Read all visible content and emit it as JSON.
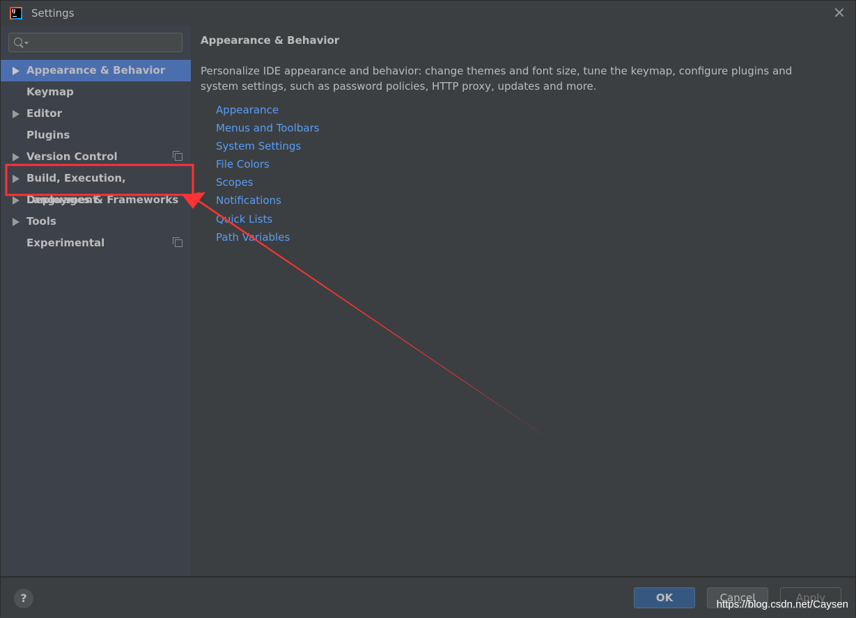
{
  "window": {
    "title": "Settings",
    "app_icon": "intellij-idea-icon",
    "close_icon": "close-icon"
  },
  "sidebar": {
    "search": {
      "value": "",
      "placeholder": ""
    },
    "items": [
      {
        "label": "Appearance & Behavior",
        "expandable": true,
        "selected": true,
        "project_icon": false
      },
      {
        "label": "Keymap",
        "expandable": false,
        "selected": false,
        "project_icon": false
      },
      {
        "label": "Editor",
        "expandable": true,
        "selected": false,
        "project_icon": false
      },
      {
        "label": "Plugins",
        "expandable": false,
        "selected": false,
        "project_icon": false
      },
      {
        "label": "Version Control",
        "expandable": true,
        "selected": false,
        "project_icon": true
      },
      {
        "label": "Build, Execution, Deployment",
        "expandable": true,
        "selected": false,
        "project_icon": false
      },
      {
        "label": "Languages & Frameworks",
        "expandable": true,
        "selected": false,
        "project_icon": false
      },
      {
        "label": "Tools",
        "expandable": true,
        "selected": false,
        "project_icon": false
      },
      {
        "label": "Experimental",
        "expandable": false,
        "selected": false,
        "project_icon": true
      }
    ]
  },
  "content": {
    "heading": "Appearance & Behavior",
    "description": "Personalize IDE appearance and behavior: change themes and font size, tune the keymap, configure plugins and system settings, such as password policies, HTTP proxy, updates and more.",
    "links": [
      "Appearance",
      "Menus and Toolbars",
      "System Settings",
      "File Colors",
      "Scopes",
      "Notifications",
      "Quick Lists",
      "Path Variables"
    ]
  },
  "footer": {
    "help_label": "?",
    "ok_label": "OK",
    "cancel_label": "Cancel",
    "apply_label": "Apply",
    "watermark": "https://blog.csdn.net/Caysen"
  },
  "annotation": {
    "highlighted_item": "Build, Execution, Deployment",
    "color": "#ff3333"
  },
  "colors": {
    "selection": "#4b6eaf",
    "link": "#589df6",
    "ok_button": "#365880"
  }
}
